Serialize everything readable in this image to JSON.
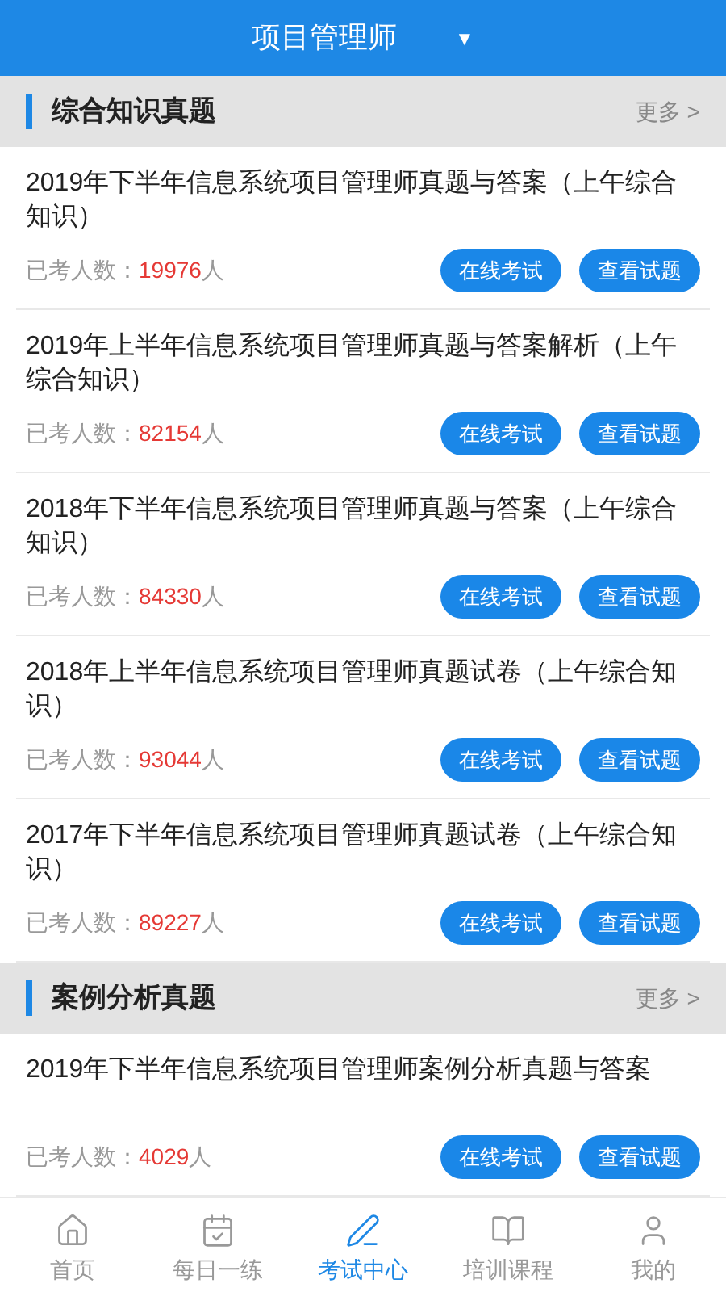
{
  "header": {
    "title": "项目管理师",
    "dropdown": "▼"
  },
  "sections": [
    {
      "title": "综合知识真题",
      "more": "更多 >",
      "items": [
        {
          "title": "2019年下半年信息系统项目管理师真题与答案（上午综合知识）",
          "count_label": "已考人数：",
          "count": "19976",
          "unit": "人",
          "buttons": [
            "在线考试",
            "查看试题"
          ]
        },
        {
          "title": "2019年上半年信息系统项目管理师真题与答案解析（上午综合知识）",
          "count_label": "已考人数：",
          "count": "82154",
          "unit": "人",
          "buttons": [
            "在线考试",
            "查看试题"
          ]
        },
        {
          "title": "2018年下半年信息系统项目管理师真题与答案（上午综合知识）",
          "count_label": "已考人数：",
          "count": "84330",
          "unit": "人",
          "buttons": [
            "在线考试",
            "查看试题"
          ]
        },
        {
          "title": "2018年上半年信息系统项目管理师真题试卷（上午综合知识）",
          "count_label": "已考人数：",
          "count": "93044",
          "unit": "人",
          "buttons": [
            "在线考试",
            "查看试题"
          ]
        },
        {
          "title": "2017年下半年信息系统项目管理师真题试卷（上午综合知识）",
          "count_label": "已考人数：",
          "count": "89227",
          "unit": "人",
          "buttons": [
            "在线考试",
            "查看试题"
          ]
        }
      ]
    },
    {
      "title": "案例分析真题",
      "more": "更多 >",
      "items": [
        {
          "title": "2019年下半年信息系统项目管理师案例分析真题与答案",
          "count_label": "已考人数：",
          "count": "4029",
          "unit": "人",
          "buttons": [
            "在线考试",
            "查看试题"
          ]
        }
      ]
    }
  ],
  "tabs": [
    {
      "kind": "home",
      "label": "首页",
      "selected": false
    },
    {
      "kind": "calendar",
      "label": "每日一练",
      "selected": false
    },
    {
      "kind": "pencil",
      "label": "考试中心",
      "selected": true
    },
    {
      "kind": "book",
      "label": "培训课程",
      "selected": false
    },
    {
      "kind": "user",
      "label": "我的",
      "selected": false
    }
  ]
}
